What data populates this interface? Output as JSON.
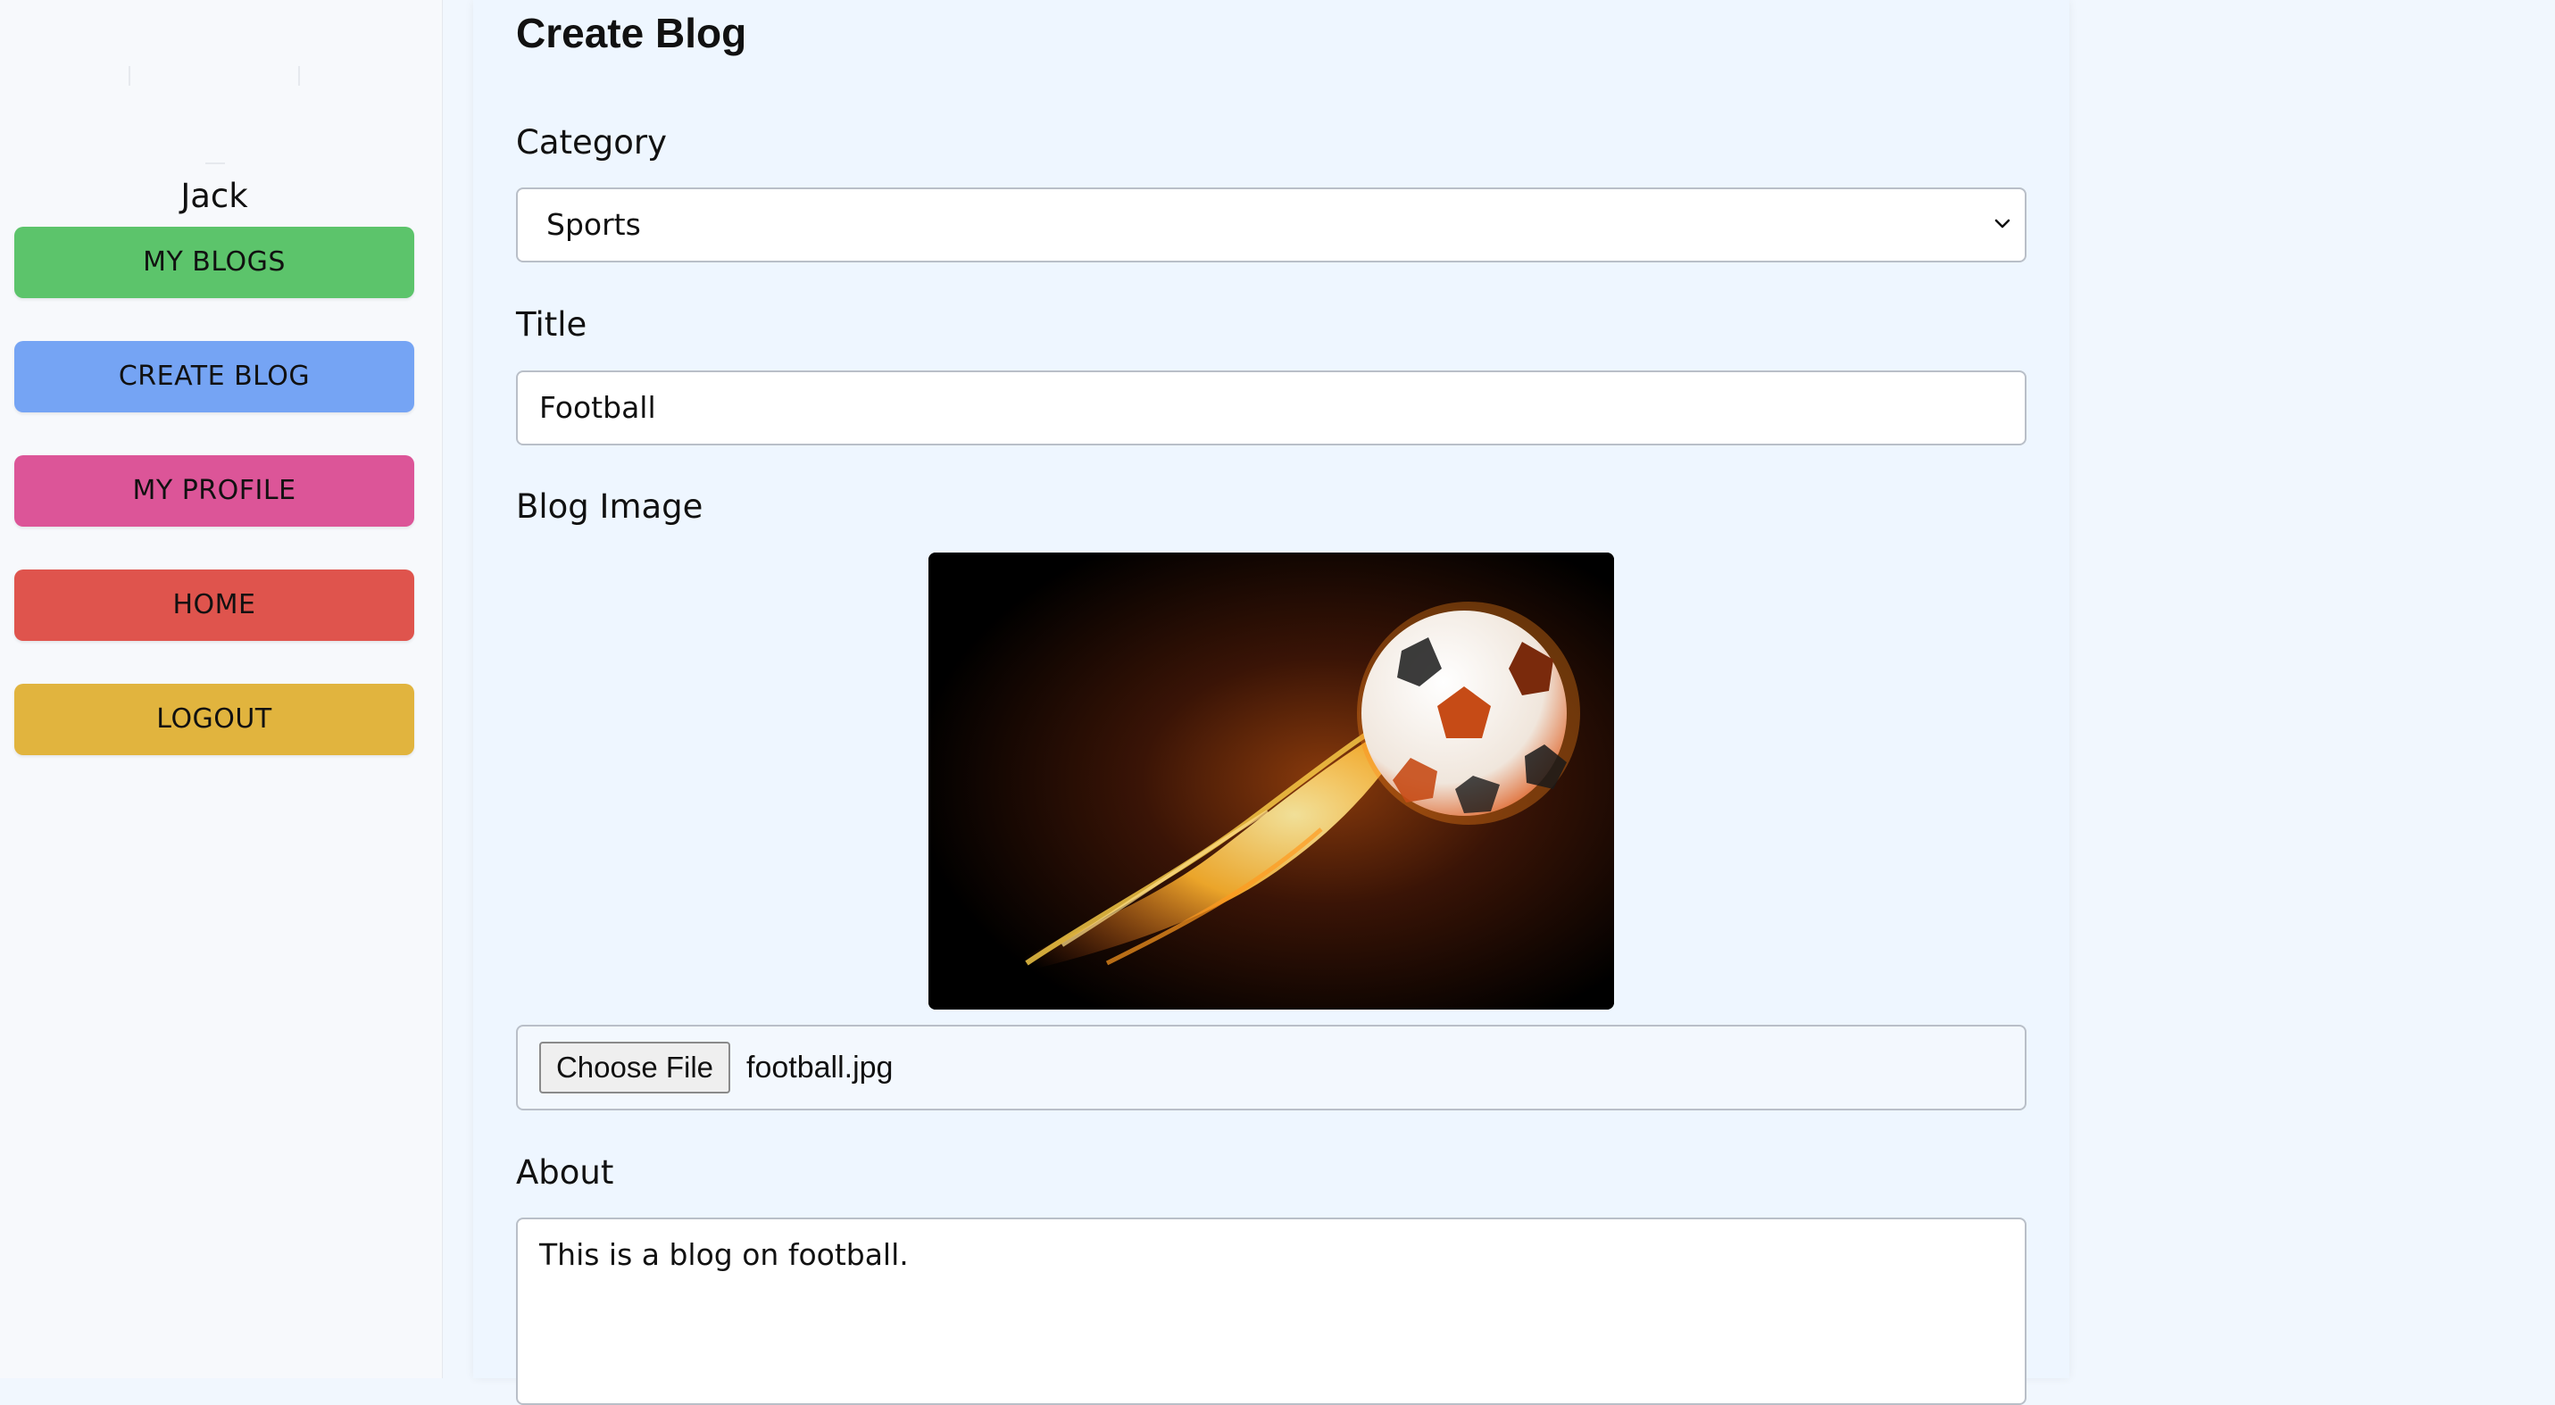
{
  "sidebar": {
    "username": "Jack",
    "items": [
      {
        "label": "MY BLOGS",
        "color": "#5cc46b"
      },
      {
        "label": "CREATE BLOG",
        "color": "#75a4f4"
      },
      {
        "label": "MY PROFILE",
        "color": "#dc5598"
      },
      {
        "label": "HOME",
        "color": "#df544d"
      },
      {
        "label": "LOGOUT",
        "color": "#e1b43e"
      }
    ]
  },
  "form": {
    "title": "Create Blog",
    "category": {
      "label": "Category",
      "selected": "Sports"
    },
    "blog_title": {
      "label": "Title",
      "value": "Football"
    },
    "image": {
      "label": "Blog Image",
      "choose_label": "Choose File",
      "file_name": "football.jpg",
      "icon": "flaming-soccer-ball"
    },
    "about": {
      "label": "About",
      "value": "This is a blog on football."
    }
  },
  "colors": {
    "page_background": "#f1f7fe",
    "sidebar_background": "#f7f9fc",
    "input_border": "#b9bfc8"
  }
}
